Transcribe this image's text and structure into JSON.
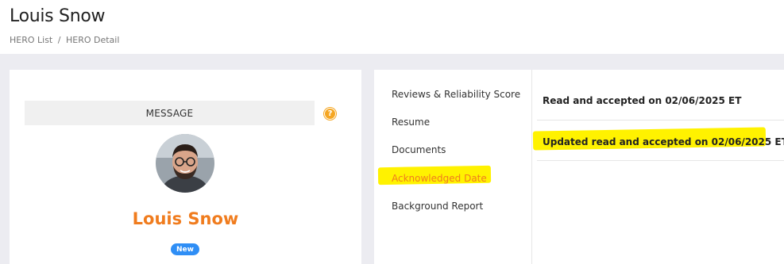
{
  "header": {
    "title": "Louis Snow",
    "breadcrumb": {
      "list_label": "HERO List",
      "separator": "/",
      "detail_label": "HERO Detail"
    }
  },
  "profile": {
    "message_label": "MESSAGE",
    "help_icon_glyph": "?",
    "name": "Louis Snow",
    "status_badge": "New",
    "accent_color": "#f07c1e",
    "badge_color": "#2f8ef5"
  },
  "nav": {
    "items": [
      {
        "label": "Reviews & Reliability Score"
      },
      {
        "label": "Resume"
      },
      {
        "label": "Documents"
      },
      {
        "label": "Acknowledged Date",
        "active": true
      },
      {
        "label": "Background Report"
      }
    ]
  },
  "content": {
    "rows": [
      {
        "text": "Read and accepted on 02/06/2025 ET"
      },
      {
        "text": "Updated read and accepted on 02/06/2025 ET",
        "highlighted": true
      }
    ]
  },
  "icons": {
    "help": "question-circle-icon",
    "avatar": "user-photo"
  },
  "colors": {
    "highlight": "#fff200"
  }
}
